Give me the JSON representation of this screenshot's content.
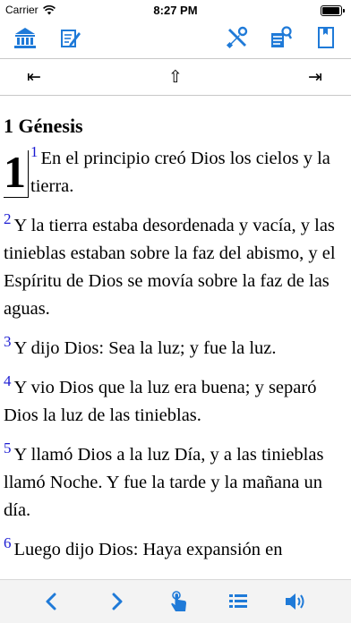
{
  "status": {
    "carrier": "Carrier",
    "time": "8:27 PM"
  },
  "toolbar": {
    "left": [
      "bank-icon",
      "edit-note-icon"
    ],
    "right": [
      "tools-icon",
      "search-text-icon",
      "bookmark-page-icon"
    ]
  },
  "nav": {
    "prev": "⇤",
    "up": "⇧",
    "next": "⇥"
  },
  "reader": {
    "book_title": "1 Génesis",
    "chapter": "1",
    "verses": [
      {
        "num": "1",
        "text": "En el principio creó Dios los cielos y la tierra."
      },
      {
        "num": "2",
        "text": "Y la tierra estaba desordenada y vacía, y las tinieblas estaban sobre la faz del abismo, y el Espíritu de Dios se movía sobre la faz de las aguas."
      },
      {
        "num": "3",
        "text": "Y dijo Dios: Sea la luz; y fue la luz."
      },
      {
        "num": "4",
        "text": "Y vio Dios que la luz era buena; y separó Dios la luz de las tinieblas."
      },
      {
        "num": "5",
        "text": "Y llamó Dios a la luz Día, y a las tinieblas llamó Noche. Y fue la tarde y la mañana un día."
      },
      {
        "num": "6",
        "text": "Luego dijo Dios: Haya expansión en"
      }
    ]
  },
  "bottom_bar": [
    "chevron-left-icon",
    "chevron-right-icon",
    "tap-icon",
    "list-icon",
    "speaker-icon"
  ],
  "colors": {
    "accent": "#1f7ad8",
    "verse_number": "#1a1ad2"
  }
}
